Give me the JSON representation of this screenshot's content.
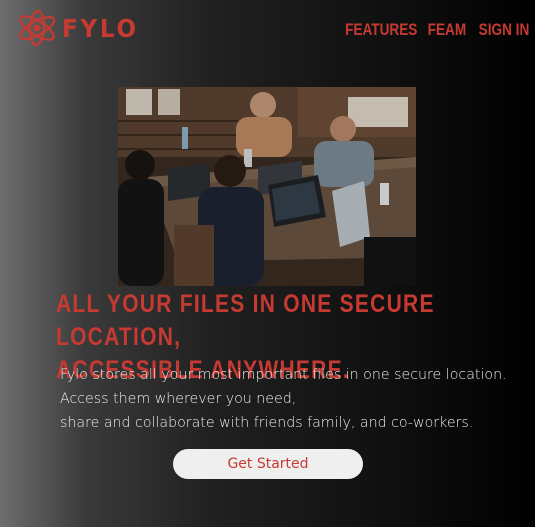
{
  "header": {
    "brand": "FYLO",
    "logo_icon": "atom-orbit-icon",
    "nav": [
      {
        "label": "FEATURES"
      },
      {
        "label": "FEAM"
      },
      {
        "label": "SIGN IN"
      }
    ]
  },
  "hero": {
    "photo": "team-working-on-laptops-photo",
    "headline": "ALL YOUR FILES IN ONE SECURE LOCATION,\nACCESSIBLE ANYWHERE.",
    "description": "Fylo stores all your most important files in one secure location.\nAccess them wherever you need,\nshare and collaborate with friends family, and co-workers.",
    "cta_label": "Get Started"
  },
  "colors": {
    "accent": "#c73a31",
    "text": "#e9e9e9",
    "button_bg": "#efefef"
  }
}
